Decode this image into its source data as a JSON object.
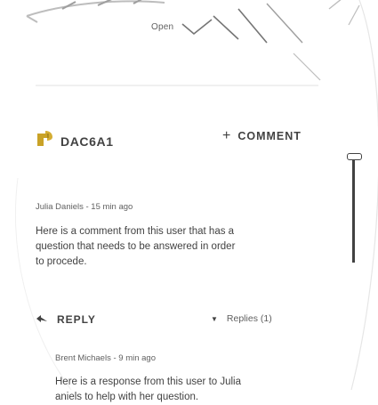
{
  "header": {
    "label": "Open"
  },
  "thread": {
    "id": "DAC6A1"
  },
  "actions": {
    "comment_label": "COMMENT",
    "reply_label": "REPLY",
    "replies_label": "Replies (1)"
  },
  "comment": {
    "author_meta": "Julia Daniels - 15 min ago",
    "lines": [
      "Here is a comment from this user that has a",
      "question that needs to be answered in order",
      "to procede."
    ]
  },
  "reply": {
    "author_meta": "Brent Michaels - 9 min ago",
    "lines": [
      "Here is a response from this user to Julia",
      "aniels to help with her question."
    ]
  },
  "colors": {
    "text": "#424242",
    "muted": "#616161",
    "icon_gold": "#c9a227",
    "outline": "#cfcfcf"
  },
  "icons": {
    "thread": "pin-icon",
    "reply": "reply-arrow-icon",
    "replies": "chevron-down-icon",
    "comment": "plus-icon"
  }
}
